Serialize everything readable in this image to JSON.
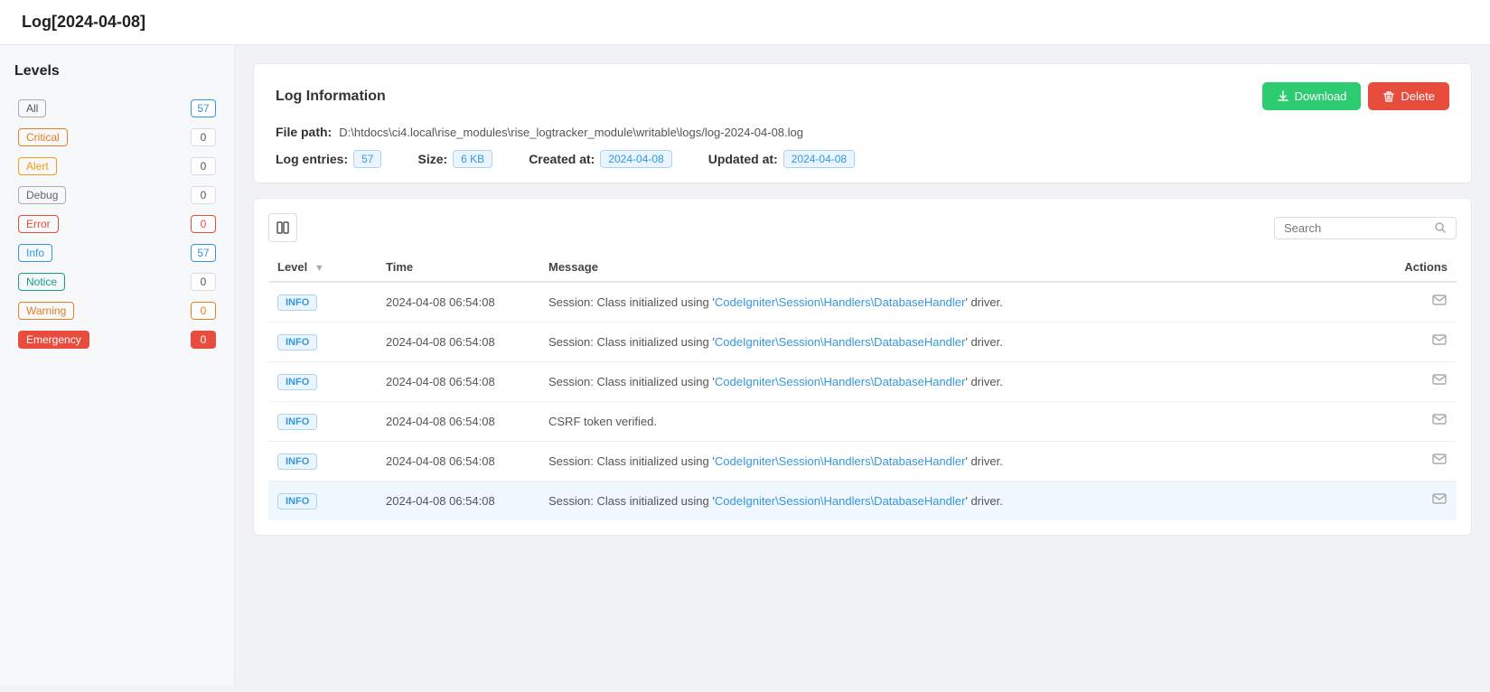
{
  "page": {
    "title": "Log[2024-04-08]"
  },
  "sidebar": {
    "title": "Levels",
    "items": [
      {
        "id": "all",
        "label": "All",
        "badgeClass": "all",
        "count": "57",
        "countClass": "has-count"
      },
      {
        "id": "critical",
        "label": "Critical",
        "badgeClass": "critical",
        "count": "0",
        "countClass": ""
      },
      {
        "id": "alert",
        "label": "Alert",
        "badgeClass": "alert",
        "count": "0",
        "countClass": ""
      },
      {
        "id": "debug",
        "label": "Debug",
        "badgeClass": "debug",
        "count": "0",
        "countClass": ""
      },
      {
        "id": "error",
        "label": "Error",
        "badgeClass": "error",
        "count": "0",
        "countClass": "error-count"
      },
      {
        "id": "info",
        "label": "Info",
        "badgeClass": "info",
        "count": "57",
        "countClass": "has-count"
      },
      {
        "id": "notice",
        "label": "Notice",
        "badgeClass": "notice",
        "count": "0",
        "countClass": ""
      },
      {
        "id": "warning",
        "label": "Warning",
        "badgeClass": "warning",
        "count": "0",
        "countClass": "warn-count"
      },
      {
        "id": "emergency",
        "label": "Emergency",
        "badgeClass": "emergency",
        "count": "0",
        "countClass": "emerg-count"
      }
    ]
  },
  "logInfo": {
    "title": "Log Information",
    "downloadLabel": "Download",
    "deleteLabel": "Delete",
    "filePathLabel": "File path:",
    "filePathValue": "D:\\htdocs\\ci4.local\\rise_modules\\rise_logtracker_module\\writable\\logs/log-2024-04-08.log",
    "logEntriesLabel": "Log entries:",
    "logEntriesValue": "57",
    "sizeLabel": "Size:",
    "sizeValue": "6 KB",
    "createdAtLabel": "Created at:",
    "createdAtValue": "2024-04-08",
    "updatedAtLabel": "Updated at:",
    "updatedAtValue": "2024-04-08"
  },
  "table": {
    "searchPlaceholder": "Search",
    "columns": {
      "level": "Level",
      "time": "Time",
      "message": "Message",
      "actions": "Actions"
    },
    "rows": [
      {
        "level": "INFO",
        "time": "2024-04-08 06:54:08",
        "message": "Session: Class initialized using 'CodeIgniter\\Session\\Handlers\\DatabaseHandler' driver.",
        "highlighted": false
      },
      {
        "level": "INFO",
        "time": "2024-04-08 06:54:08",
        "message": "Session: Class initialized using 'CodeIgniter\\Session\\Handlers\\DatabaseHandler' driver.",
        "highlighted": false
      },
      {
        "level": "INFO",
        "time": "2024-04-08 06:54:08",
        "message": "Session: Class initialized using 'CodeIgniter\\Session\\Handlers\\DatabaseHandler' driver.",
        "highlighted": false
      },
      {
        "level": "INFO",
        "time": "2024-04-08 06:54:08",
        "message": "CSRF token verified.",
        "highlighted": false
      },
      {
        "level": "INFO",
        "time": "2024-04-08 06:54:08",
        "message": "Session: Class initialized using 'CodeIgniter\\Session\\Handlers\\DatabaseHandler' driver.",
        "highlighted": false
      },
      {
        "level": "INFO",
        "time": "2024-04-08 06:54:08",
        "message": "Session: Class initialized using 'CodeIgniter\\Session\\Handlers\\DatabaseHandler' driver.",
        "highlighted": true
      }
    ]
  }
}
